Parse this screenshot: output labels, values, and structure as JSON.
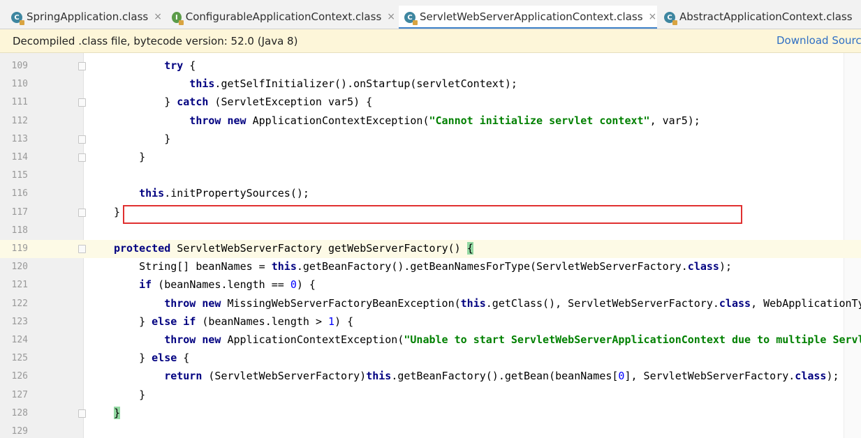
{
  "tabs": [
    {
      "label": "SpringApplication.class",
      "icon": "c",
      "active": false
    },
    {
      "label": "ConfigurableApplicationContext.class",
      "icon": "i",
      "active": false
    },
    {
      "label": "ServletWebServerApplicationContext.class",
      "icon": "c",
      "active": true
    },
    {
      "label": "AbstractApplicationContext.class",
      "icon": "c",
      "active": false
    }
  ],
  "tab_icon_letters": {
    "c": "C",
    "i": "I"
  },
  "tab_close_glyph": "×",
  "notice": {
    "text": "Decompiled .class file, bytecode version: 52.0 (Java 8)",
    "link": "Download Sources"
  },
  "code_lines": [
    {
      "num": "109",
      "indent": 2,
      "tokens": [
        [
          "kw",
          "try"
        ],
        [
          "t",
          " {"
        ]
      ]
    },
    {
      "num": "110",
      "indent": 3,
      "tokens": [
        [
          "kw",
          "this"
        ],
        [
          "t",
          ".getSelfInitializer().onStartup(servletContext);"
        ]
      ]
    },
    {
      "num": "111",
      "indent": 2,
      "tokens": [
        [
          "t",
          "} "
        ],
        [
          "kw",
          "catch"
        ],
        [
          "t",
          " (ServletException var5) {"
        ]
      ]
    },
    {
      "num": "112",
      "indent": 3,
      "tokens": [
        [
          "kw",
          "throw new"
        ],
        [
          "t",
          " ApplicationContextException("
        ],
        [
          "str",
          "\"Cannot initialize servlet context\""
        ],
        [
          "t",
          ", var5);"
        ]
      ]
    },
    {
      "num": "113",
      "indent": 2,
      "tokens": [
        [
          "t",
          "}"
        ]
      ]
    },
    {
      "num": "114",
      "indent": 1,
      "tokens": [
        [
          "t",
          "}"
        ]
      ]
    },
    {
      "num": "115",
      "indent": 0,
      "tokens": []
    },
    {
      "num": "116",
      "indent": 1,
      "tokens": [
        [
          "kw",
          "this"
        ],
        [
          "t",
          ".initPropertySources();"
        ]
      ]
    },
    {
      "num": "117",
      "indent": 0,
      "tokens": [
        [
          "t",
          "}"
        ]
      ]
    },
    {
      "num": "118",
      "indent": 0,
      "tokens": []
    },
    {
      "num": "119",
      "indent": 0,
      "tokens": [
        [
          "kw",
          "protected"
        ],
        [
          "t",
          " ServletWebServerFactory getWebServerFactory() "
        ],
        [
          "brace",
          "{"
        ]
      ]
    },
    {
      "num": "120",
      "indent": 1,
      "tokens": [
        [
          "t",
          "String[] beanNames = "
        ],
        [
          "kw",
          "this"
        ],
        [
          "t",
          ".getBeanFactory().getBeanNamesForType(ServletWebServerFactory."
        ],
        [
          "kw",
          "class"
        ],
        [
          "t",
          ");"
        ]
      ]
    },
    {
      "num": "121",
      "indent": 1,
      "tokens": [
        [
          "kw",
          "if"
        ],
        [
          "t",
          " (beanNames.length == "
        ],
        [
          "num",
          "0"
        ],
        [
          "t",
          ") {"
        ]
      ]
    },
    {
      "num": "122",
      "indent": 2,
      "tokens": [
        [
          "kw",
          "throw new"
        ],
        [
          "t",
          " MissingWebServerFactoryBeanException("
        ],
        [
          "kw",
          "this"
        ],
        [
          "t",
          ".getClass(), ServletWebServerFactory."
        ],
        [
          "kw",
          "class"
        ],
        [
          "t",
          ", WebApplicationTy"
        ]
      ]
    },
    {
      "num": "123",
      "indent": 1,
      "tokens": [
        [
          "t",
          "} "
        ],
        [
          "kw",
          "else if"
        ],
        [
          "t",
          " (beanNames.length > "
        ],
        [
          "num",
          "1"
        ],
        [
          "t",
          ") {"
        ]
      ]
    },
    {
      "num": "124",
      "indent": 2,
      "tokens": [
        [
          "kw",
          "throw new"
        ],
        [
          "t",
          " ApplicationContextException("
        ],
        [
          "str",
          "\"Unable to start ServletWebServerApplicationContext due to multiple Servl"
        ]
      ]
    },
    {
      "num": "125",
      "indent": 1,
      "tokens": [
        [
          "t",
          "} "
        ],
        [
          "kw",
          "else"
        ],
        [
          "t",
          " {"
        ]
      ]
    },
    {
      "num": "126",
      "indent": 2,
      "tokens": [
        [
          "kw",
          "return"
        ],
        [
          "t",
          " (ServletWebServerFactory)"
        ],
        [
          "kw",
          "this"
        ],
        [
          "t",
          ".getBeanFactory().getBean(beanNames["
        ],
        [
          "num",
          "0"
        ],
        [
          "t",
          "], ServletWebServerFactory."
        ],
        [
          "kw",
          "class"
        ],
        [
          "t",
          ");"
        ]
      ]
    },
    {
      "num": "127",
      "indent": 1,
      "tokens": [
        [
          "t",
          "}"
        ]
      ]
    },
    {
      "num": "128",
      "indent": 0,
      "tokens": [
        [
          "brace",
          "}"
        ]
      ]
    },
    {
      "num": "129",
      "indent": 0,
      "tokens": []
    }
  ],
  "caret_line": "119",
  "highlighted_line": "120",
  "colors": {
    "keyword": "#000080",
    "string": "#008000",
    "number": "#0000ff",
    "highlight_border": "#e03030",
    "active_tab_underline": "#4083c9",
    "notice_background": "#fdf6d9"
  }
}
